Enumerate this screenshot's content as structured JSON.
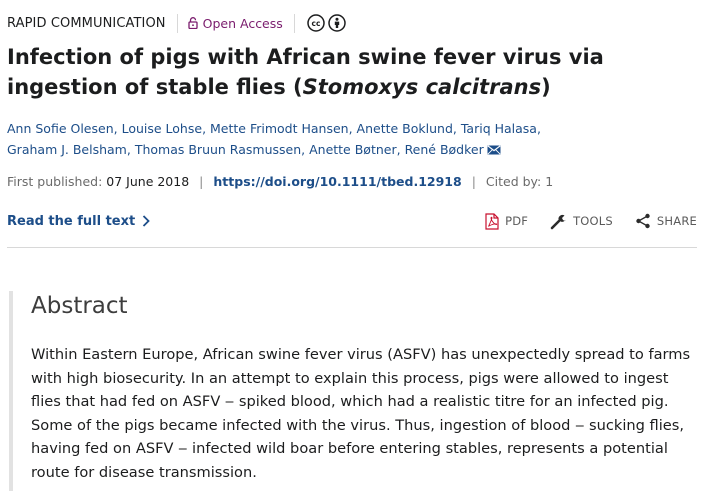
{
  "header": {
    "article_type": "RAPID COMMUNICATION",
    "open_access": "Open Access",
    "license_icons": [
      "creative-commons-icon",
      "attribution-icon"
    ]
  },
  "title": {
    "main": "Infection of pigs with African swine fever virus via ingestion of stable flies (",
    "species": "Stomoxys calcitrans",
    "close": ")"
  },
  "authors": [
    "Ann Sofie Olesen",
    "Louise Lohse",
    "Mette Frimodt Hansen",
    "Anette Boklund",
    "Tariq Halasa",
    "Graham J. Belsham",
    "Thomas Bruun Rasmussen",
    "Anette Bøtner",
    "René Bødker"
  ],
  "publication": {
    "first_published_label": "First published:",
    "first_published_date": "07 June 2018",
    "doi": "https://doi.org/10.1111/tbed.12918",
    "cited_by": "Cited by: 1"
  },
  "actions": {
    "read_full_text": "Read the full text",
    "pdf": "PDF",
    "tools": "TOOLS",
    "share": "SHARE"
  },
  "abstract": {
    "heading": "Abstract",
    "text": "Within Eastern Europe, African swine fever virus (ASFV) has unexpectedly spread to farms with high biosecurity. In an attempt to explain this process, pigs were allowed to ingest flies that had fed on ASFV ‒ spiked blood, which had a realistic titre for an infected pig. Some of the pigs became infected with the virus. Thus, ingestion of blood ‒ sucking flies, having fed on ASFV ‒ infected wild boar before entering stables, represents a potential route for disease transmission."
  },
  "colors": {
    "link": "#1d4e89",
    "open_access": "#7a1c6d",
    "pdf_red": "#c8102e",
    "rule": "#d8d8d8"
  }
}
